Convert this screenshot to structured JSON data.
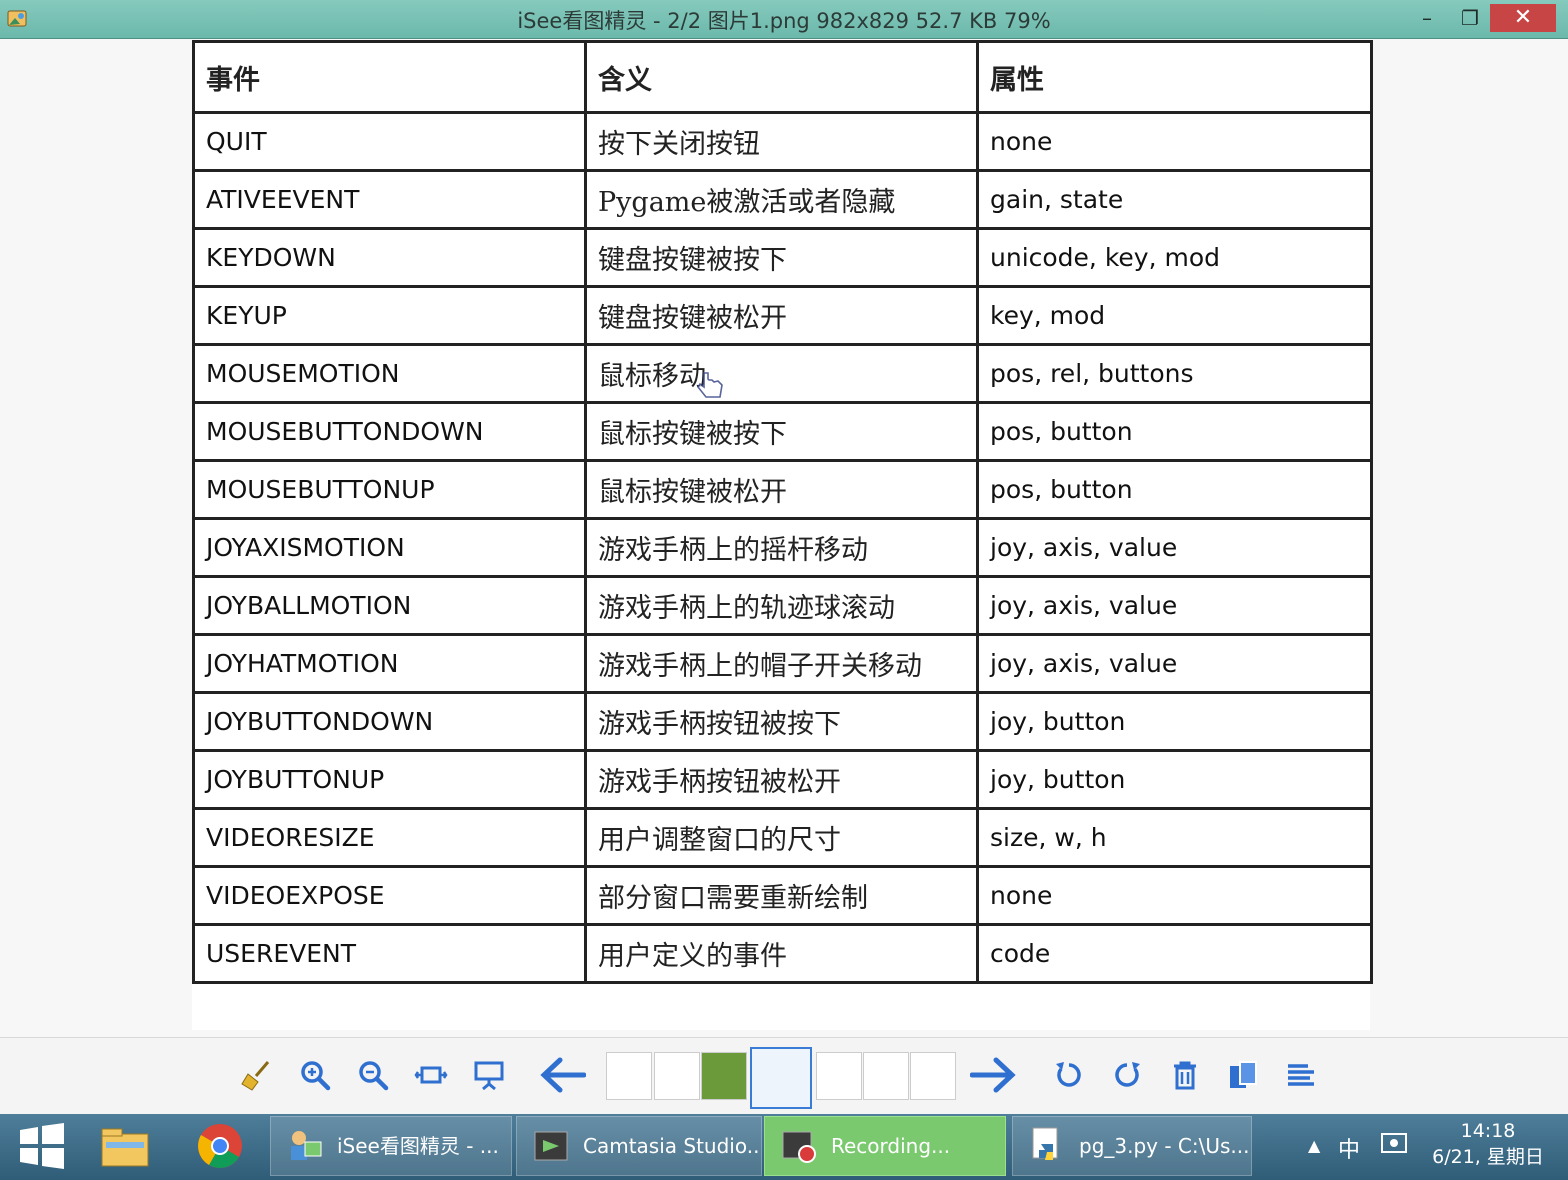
{
  "window": {
    "title": "iSee看图精灵 - 2/2  图片1.png  982x829  52.7 KB  79%",
    "min_glyph": "–",
    "max_glyph": "❐",
    "close_glyph": "✕"
  },
  "table": {
    "headers": [
      "事件",
      "含义",
      "属性"
    ],
    "rows": [
      [
        "QUIT",
        "按下关闭按钮",
        "none"
      ],
      [
        "ATIVEEVENT",
        "Pygame被激活或者隐藏",
        "gain, state"
      ],
      [
        "KEYDOWN",
        "键盘按键被按下",
        "unicode, key, mod"
      ],
      [
        "KEYUP",
        "键盘按键被松开",
        "key, mod"
      ],
      [
        "MOUSEMOTION",
        "鼠标移动",
        "pos, rel, buttons"
      ],
      [
        "MOUSEBUTTONDOWN",
        "鼠标按键被按下",
        "pos, button"
      ],
      [
        "MOUSEBUTTONUP",
        "鼠标按键被松开",
        "pos, button"
      ],
      [
        "JOYAXISMOTION",
        "游戏手柄上的摇杆移动",
        "joy, axis, value"
      ],
      [
        "JOYBALLMOTION",
        "游戏手柄上的轨迹球滚动",
        "joy, axis, value"
      ],
      [
        "JOYHATMOTION",
        "游戏手柄上的帽子开关移动",
        "joy, axis, value"
      ],
      [
        "JOYBUTTONDOWN",
        "游戏手柄按钮被按下",
        "joy, button"
      ],
      [
        "JOYBUTTONUP",
        "游戏手柄按钮被松开",
        "joy, button"
      ],
      [
        "VIDEORESIZE",
        "用户调整窗口的尺寸",
        "size, w, h"
      ],
      [
        "VIDEOEXPOSE",
        "部分窗口需要重新绘制",
        "none"
      ],
      [
        "USEREVENT",
        "用户定义的事件",
        "code"
      ]
    ]
  },
  "taskbar": {
    "tasks": [
      {
        "label": "iSee看图精灵 - ..."
      },
      {
        "label": "Camtasia Studio..."
      },
      {
        "label": "Recording..."
      },
      {
        "label": "pg_3.py - C:\\Us..."
      }
    ],
    "ime": "中",
    "clock_time": "14:18",
    "clock_date": "6/21, 星期日"
  },
  "colors": {
    "titlebar": "#6bb9ab",
    "close_button": "#c74545",
    "toolbar_icon": "#2f6fd0",
    "active_task": "#7bc96f"
  }
}
